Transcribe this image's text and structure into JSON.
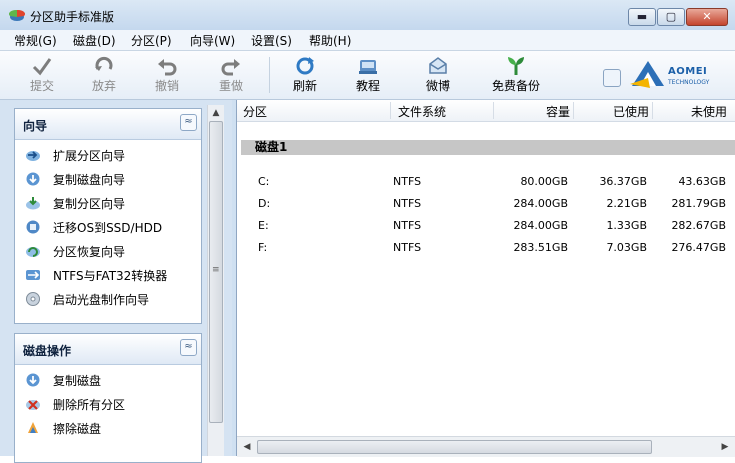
{
  "window": {
    "title": "分区助手标准版"
  },
  "titlebar": {
    "minimize": "▬",
    "maximize": "▢",
    "close": "✕"
  },
  "menu": [
    {
      "label": "常规(G)"
    },
    {
      "label": "磁盘(D)"
    },
    {
      "label": "分区(P)"
    },
    {
      "label": "向导(W)"
    },
    {
      "label": "设置(S)"
    },
    {
      "label": "帮助(H)"
    }
  ],
  "toolbar": {
    "items": [
      {
        "label": "提交",
        "icon": "commit-check-icon",
        "enabled": false
      },
      {
        "label": "放弃",
        "icon": "discard-icon",
        "enabled": false
      },
      {
        "label": "撤销",
        "icon": "undo-icon",
        "enabled": false
      },
      {
        "label": "重做",
        "icon": "redo-icon",
        "enabled": false
      },
      {
        "label": "刷新",
        "icon": "refresh-icon",
        "enabled": true
      },
      {
        "label": "教程",
        "icon": "tutorial-icon",
        "enabled": true
      },
      {
        "label": "微博",
        "icon": "weibo-icon",
        "enabled": true
      },
      {
        "label": "免费备份",
        "icon": "free-backup-icon",
        "enabled": true
      }
    ],
    "logo": {
      "brand": "AOMEI",
      "sub": "TECHNOLOGY"
    }
  },
  "sidebar": {
    "wizard_panel": {
      "title": "向导",
      "collapse_glyph": "≈",
      "items": [
        {
          "label": "扩展分区向导",
          "icon": "extend-partition-icon"
        },
        {
          "label": "复制磁盘向导",
          "icon": "copy-disk-icon"
        },
        {
          "label": "复制分区向导",
          "icon": "copy-partition-icon"
        },
        {
          "label": "迁移OS到SSD/HDD",
          "icon": "migrate-os-icon"
        },
        {
          "label": "分区恢复向导",
          "icon": "partition-recovery-icon"
        },
        {
          "label": "NTFS与FAT32转换器",
          "icon": "ntfs-fat32-convert-icon"
        },
        {
          "label": "启动光盘制作向导",
          "icon": "bootable-cd-icon"
        }
      ]
    },
    "disk_panel": {
      "title": "磁盘操作",
      "collapse_glyph": "≈",
      "items": [
        {
          "label": "复制磁盘",
          "icon": "copy-disk-icon"
        },
        {
          "label": "删除所有分区",
          "icon": "delete-all-partitions-icon"
        },
        {
          "label": "擦除磁盘",
          "icon": "wipe-disk-icon"
        }
      ]
    }
  },
  "table": {
    "columns": [
      "分区",
      "文件系统",
      "容量",
      "已使用",
      "未使用"
    ],
    "disk_label": "磁盘1",
    "rows": [
      {
        "partition": "C:",
        "fs": "NTFS",
        "capacity": "80.00GB",
        "used": "36.37GB",
        "free": "43.63GB"
      },
      {
        "partition": "D:",
        "fs": "NTFS",
        "capacity": "284.00GB",
        "used": "2.21GB",
        "free": "281.79GB"
      },
      {
        "partition": "E:",
        "fs": "NTFS",
        "capacity": "284.00GB",
        "used": "1.33GB",
        "free": "282.67GB"
      },
      {
        "partition": "F:",
        "fs": "NTFS",
        "capacity": "283.51GB",
        "used": "7.03GB",
        "free": "276.47GB"
      }
    ]
  },
  "colors": {
    "accent": "#1b5fa8",
    "panel_bg": "#d5e3f2",
    "disk_bar": "#c6c6c6"
  }
}
